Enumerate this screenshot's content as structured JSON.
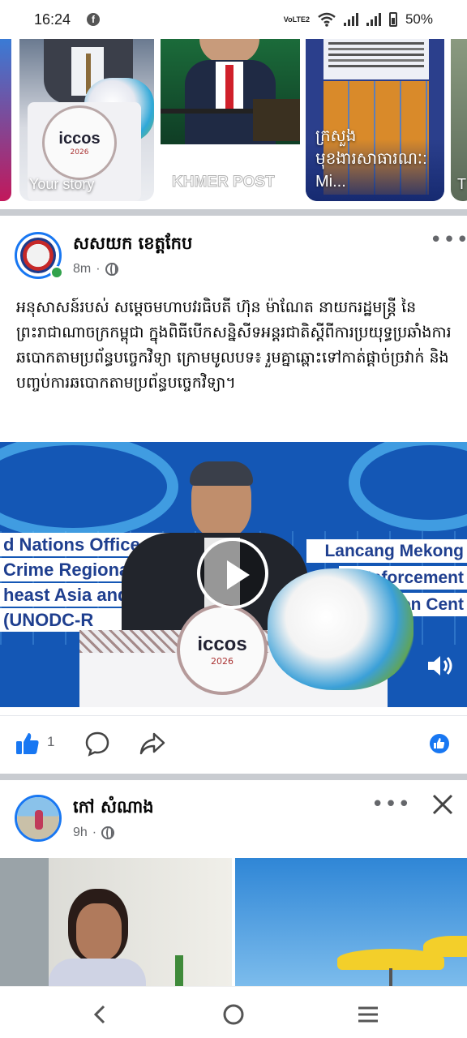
{
  "status_bar": {
    "time": "16:24",
    "notification_icon": "facebook-icon",
    "volte": "VoLTE2",
    "battery": "50%"
  },
  "stories": {
    "items": [
      {
        "label": "Your story"
      },
      {
        "label": "KHMER POST"
      },
      {
        "label": "ក្រសួងមុខងារសាធារណៈ: Mi..."
      },
      {
        "label": "T"
      }
    ],
    "podium_logo": "iccos",
    "podium_year": "2026"
  },
  "post1": {
    "author": "សសយក ខេត្តកែប",
    "time": "8m",
    "text": "អនុសាសន៍របស់ សម្តេចមហាបវរធិបតី ហ៊ុន ម៉ាណែត នាយករដ្ឋមន្រ្តី នៃព្រះរាជាណាចក្រកម្ពុជា ក្នុងពិធីបើកសន្និសីទអន្តរជាតិស្តីពីការប្រយុទ្ធប្រឆាំងការឆបោកតាមប្រព័ន្ធបច្ចេកវិទ្យា ក្រោមមូលបទ៖ រួមគ្នាឆ្ពោះទៅកាត់ផ្តាច់ច្រវាក់ និងបញ្ចប់ការឆបោកតាមប្រព័ន្ធបច្ចេកវិទ្យា។",
    "video": {
      "banner_left": [
        "d Nations Office on D",
        "Crime Regional O",
        "heast Asia and",
        "(UNODC-R"
      ],
      "banner_right": [
        "Lancang Mekong",
        "Enforcement",
        "ion Cent"
      ],
      "podium_logo": "iccos",
      "podium_year": "2026"
    },
    "like_count": "1"
  },
  "post2": {
    "author": "កៅ សំណាង",
    "time": "9h"
  },
  "colors": {
    "facebook_blue": "#1877f2",
    "online_green": "#31a24c",
    "secondary_text": "#65676b",
    "divider": "#c9ccd1"
  }
}
